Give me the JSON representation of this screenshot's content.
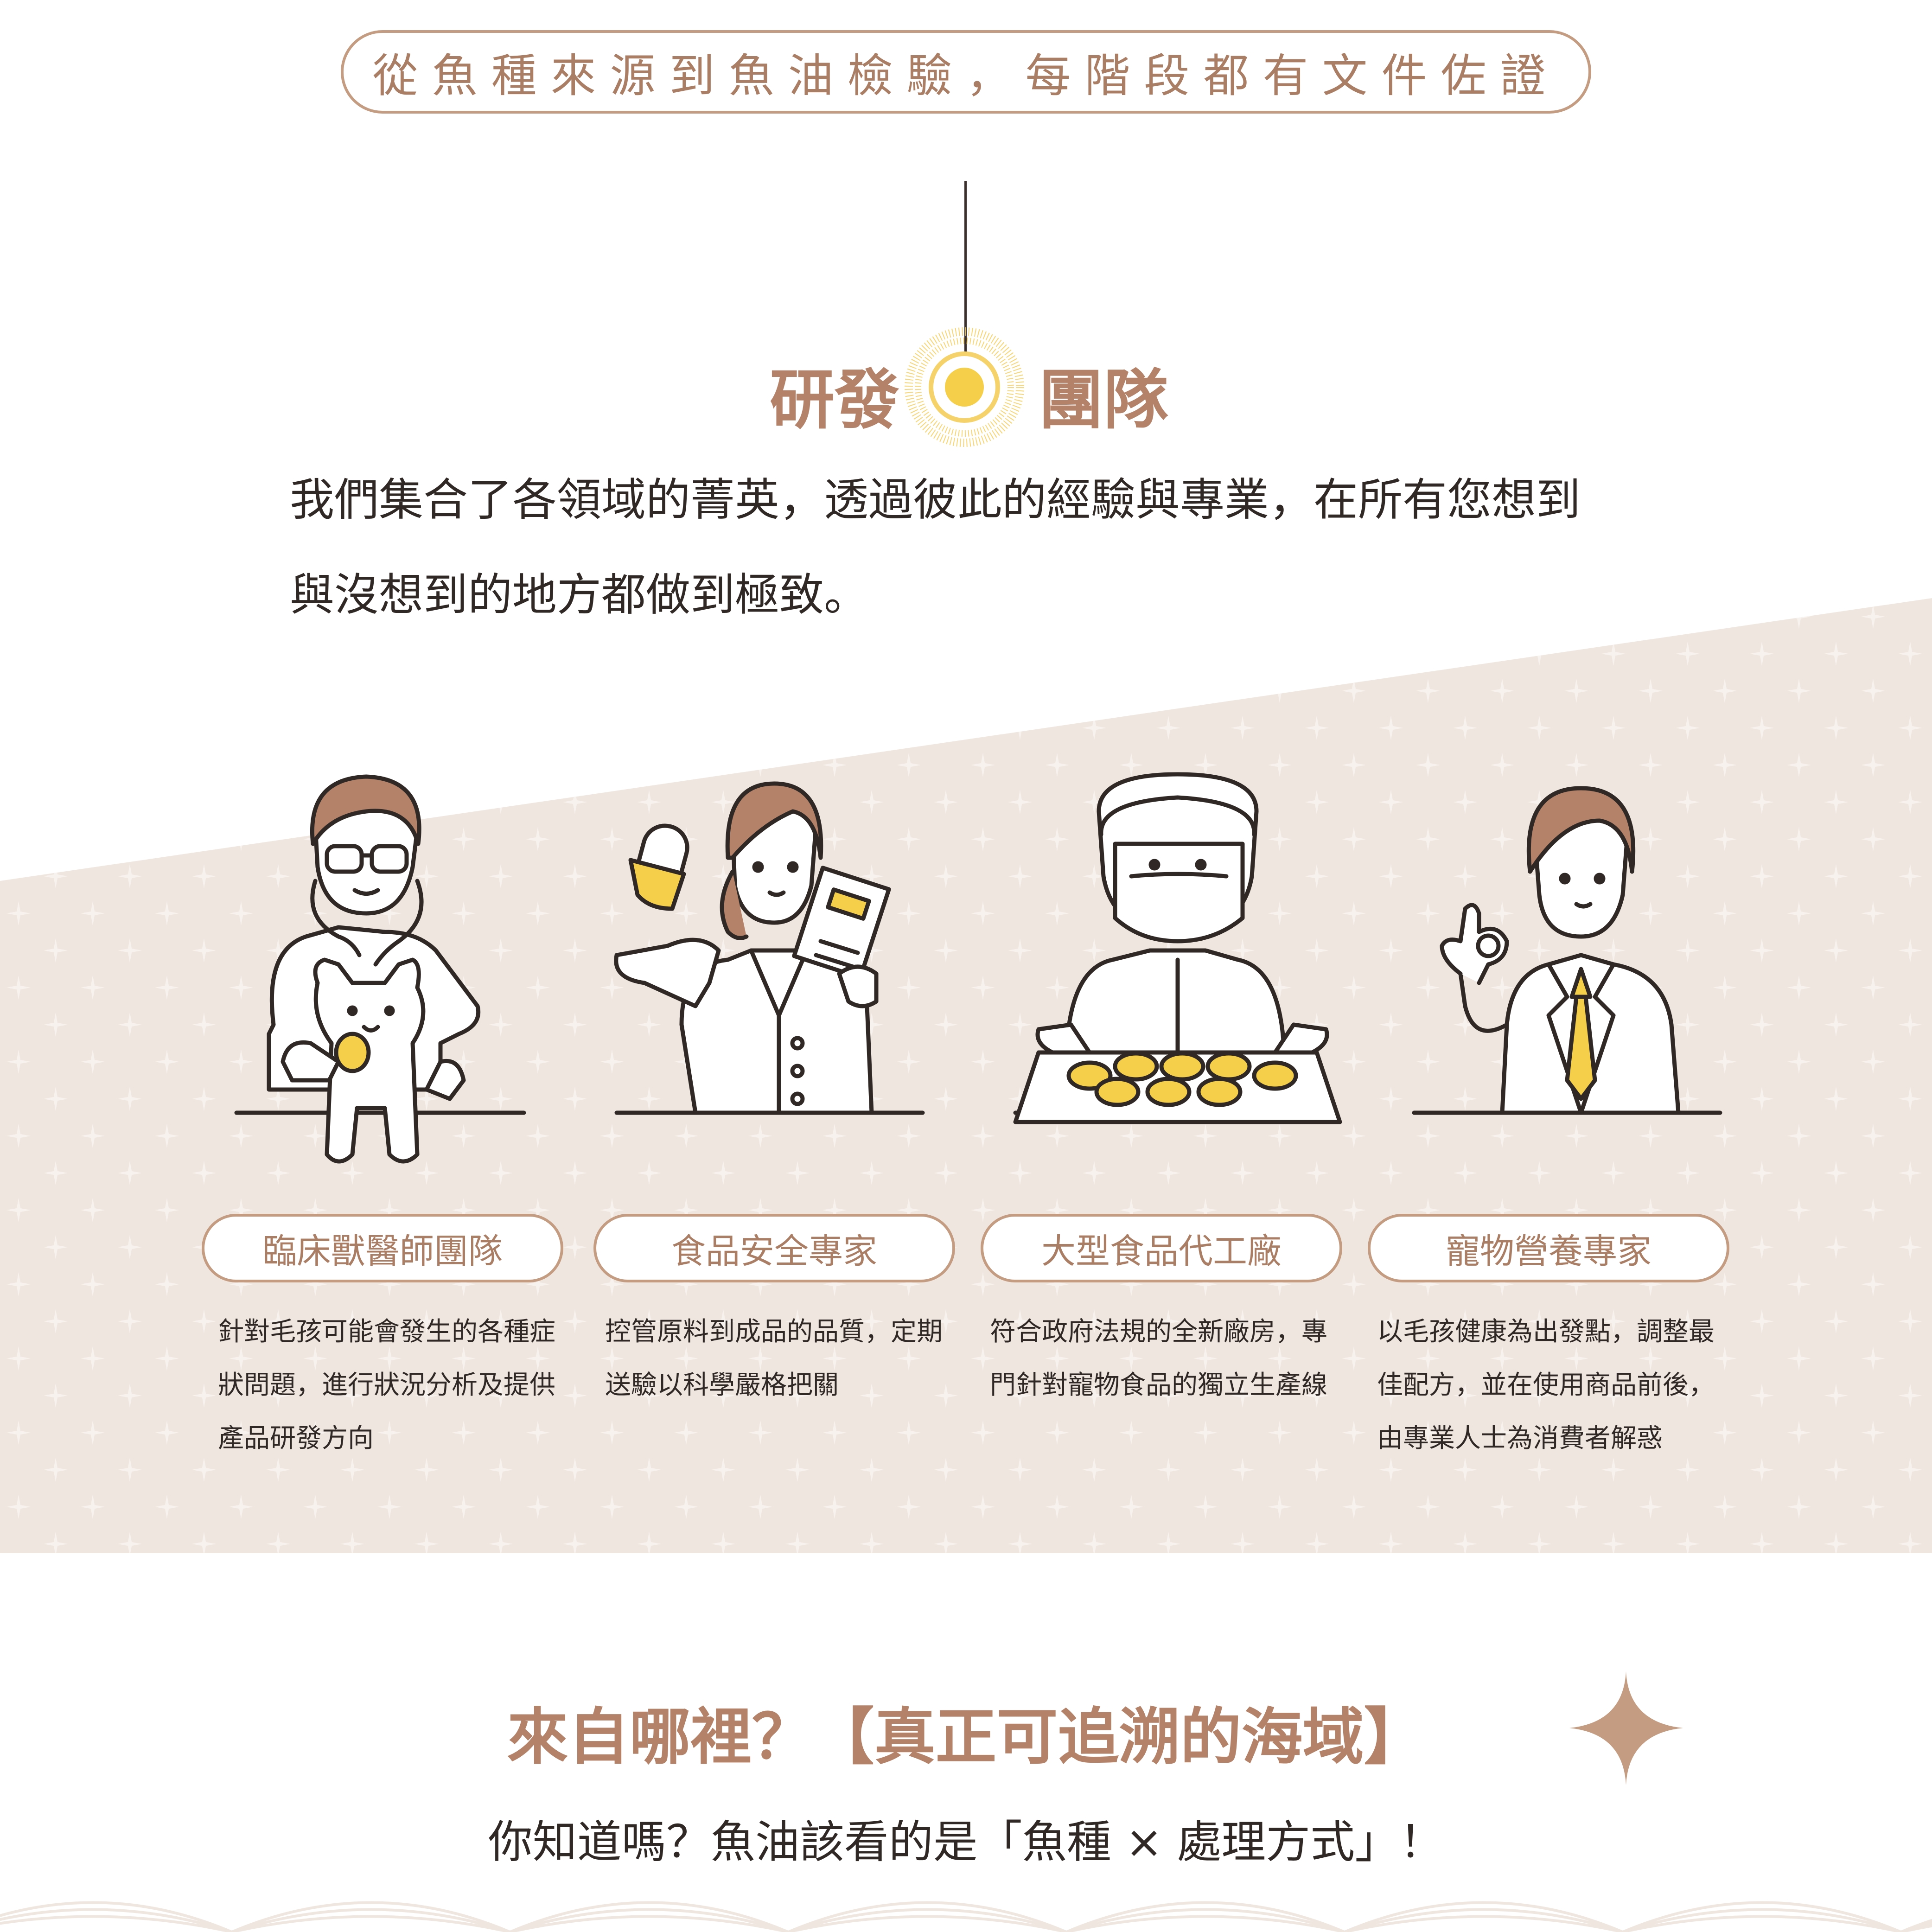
{
  "colors": {
    "accent_brown": "#b38269",
    "pill_border": "#c49c81",
    "band_bg": "#f0e6e0",
    "line_dark": "#2f2825",
    "highlight_yellow": "#f6cf4a"
  },
  "banner": {
    "text": "從魚種來源到魚油檢驗，每階段都有文件佐證"
  },
  "team": {
    "title_left": "研發",
    "title_right": "團隊",
    "intro_line1": "我們集合了各領域的菁英，透過彼此的經驗與專業，在所有您想到",
    "intro_line2": "與沒想到的地方都做到極致。"
  },
  "roles": [
    {
      "title": "臨床獸醫師團隊",
      "icon": "vet-with-cat-illustration",
      "desc": [
        "針對毛孩可能會發生的各種症",
        "狀問題，進行狀況分析及提供",
        "產品研發方向"
      ]
    },
    {
      "title": "食品安全專家",
      "icon": "food-safety-expert-illustration",
      "desc": [
        "控管原料到成品的品質，定期",
        "送驗以科學嚴格把關"
      ]
    },
    {
      "title": "大型食品代工廠",
      "icon": "factory-worker-illustration",
      "desc": [
        "符合政府法規的全新廠房，專",
        "門針對寵物食品的獨立生產線"
      ]
    },
    {
      "title": "寵物營養專家",
      "icon": "nutrition-expert-illustration",
      "desc": [
        "以毛孩健康為出發點，調整最",
        "佳配方，並在使用商品前後，",
        "由專業人士為消費者解惑"
      ]
    }
  ],
  "origin": {
    "title": "來自哪裡？【真正可追溯的海域】",
    "subtitle": "你知道嗎？魚油該看的是「魚種 × 處理方式」！"
  }
}
